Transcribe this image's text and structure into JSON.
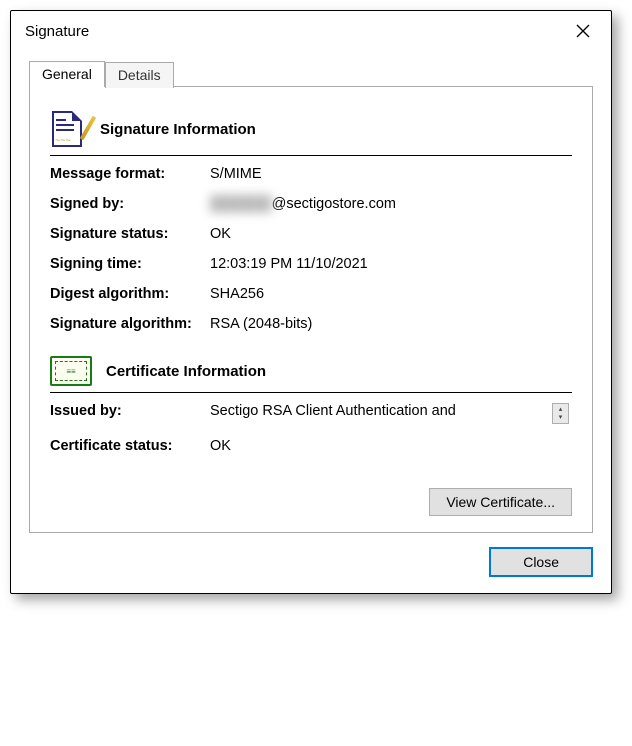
{
  "window": {
    "title": "Signature"
  },
  "tabs": {
    "general": "General",
    "details": "Details"
  },
  "signature": {
    "heading": "Signature Information",
    "rows": {
      "message_format": {
        "label": "Message format:",
        "value": "S/MIME"
      },
      "signed_by": {
        "label": "Signed by:",
        "redacted": "██████",
        "domain": "@sectigostore.com"
      },
      "status": {
        "label": "Signature status:",
        "value": "OK"
      },
      "time": {
        "label": "Signing time:",
        "value": "12:03:19 PM 11/10/2021"
      },
      "digest": {
        "label": "Digest algorithm:",
        "value": "SHA256"
      },
      "sig_alg": {
        "label": "Signature algorithm:",
        "value": "RSA (2048-bits)"
      }
    }
  },
  "certificate": {
    "heading": "Certificate Information",
    "rows": {
      "issued_by": {
        "label": "Issued by:",
        "value": "Sectigo RSA Client Authentication and"
      },
      "status": {
        "label": "Certificate status:",
        "value": "OK"
      }
    }
  },
  "buttons": {
    "view_cert": "View Certificate...",
    "close": "Close"
  }
}
